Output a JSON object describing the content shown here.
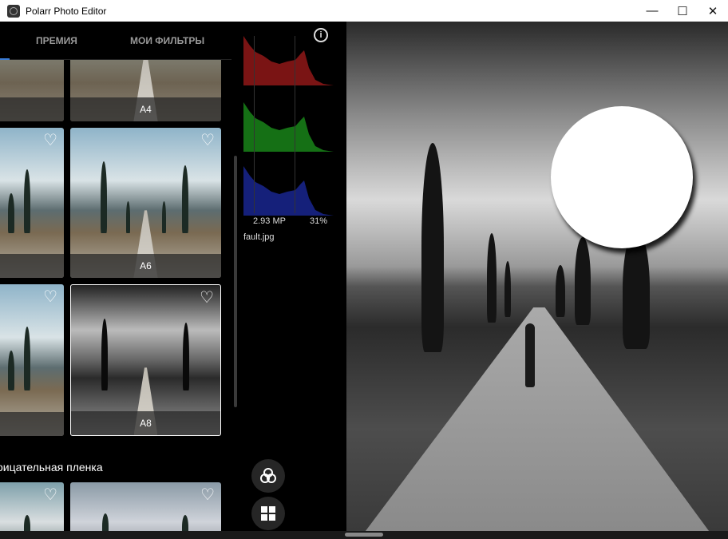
{
  "window": {
    "title": "Polarr Photo Editor",
    "minimize": "—",
    "maximize": "☐",
    "close": "✕"
  },
  "tabs": [
    {
      "label": "ПРЕМИЯ"
    },
    {
      "label": "МОИ ФИЛЬТРЫ"
    }
  ],
  "filters": {
    "tiles": [
      {
        "label": "A4"
      },
      {
        "label": "A6"
      },
      {
        "label": "A8",
        "selected": true
      }
    ],
    "section_title": "оицательная пленка"
  },
  "histogram": {
    "megapixels": "2.93 MP",
    "zoom": "31%",
    "filename": "fault.jpg",
    "colors": {
      "red": "#8b1a1a",
      "green": "#1c7a1c",
      "blue": "#1c2a8b"
    }
  },
  "icons": {
    "info": "i"
  }
}
